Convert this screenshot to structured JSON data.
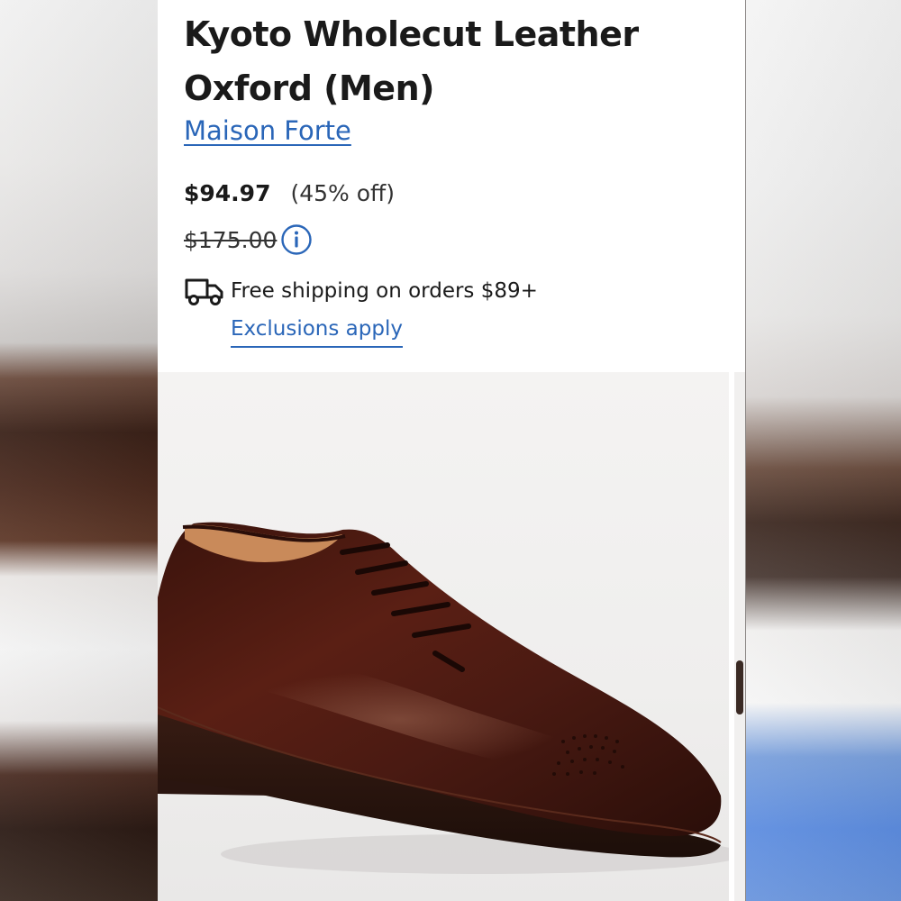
{
  "product": {
    "title_line1": "Kyoto Wholecut Leather",
    "title_line2": "Oxford (Men)",
    "brand": "Maison Forte",
    "sale_price": "$94.97",
    "discount": "(45% off)",
    "original_price": "$175.00",
    "shipping_text": "Free shipping on orders $89+",
    "exclusions_link": "Exclusions apply"
  },
  "icons": {
    "info": "info-circle-icon",
    "shipping": "truck-icon"
  },
  "colors": {
    "link": "#2a66b8",
    "text": "#1a1a1a",
    "card_background": "#ffffff",
    "shoe_leather": "#4a1a12"
  }
}
